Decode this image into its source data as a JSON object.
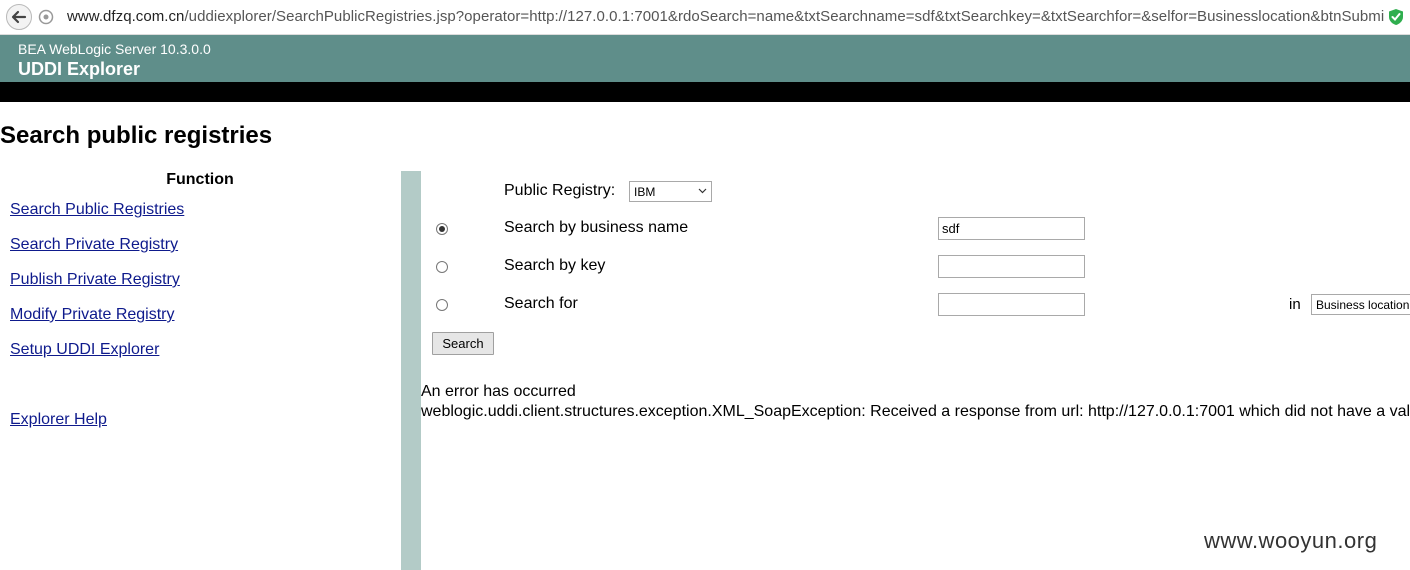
{
  "browser": {
    "url_host": "www.dfzq.com.cn",
    "url_rest": "/uddiexplorer/SearchPublicRegistries.jsp?operator=http://127.0.0.1:7001&rdoSearch=name&txtSearchname=sdf&txtSearchkey=&txtSearchfor=&selfor=Businesslocation&btnSubmi"
  },
  "header": {
    "product": "BEA WebLogic Server 10.3.0.0",
    "app_title": "UDDI Explorer"
  },
  "page_title": "Search public registries",
  "sidebar": {
    "heading": "Function",
    "items": [
      {
        "label": "Search Public Registries"
      },
      {
        "label": "Search Private Registry"
      },
      {
        "label": "Publish Private Registry"
      },
      {
        "label": "Modify Private Registry"
      },
      {
        "label": "Setup UDDI Explorer"
      }
    ],
    "help": "Explorer Help"
  },
  "form": {
    "registry_label": "Public Registry:",
    "registry_value": "IBM",
    "by_name_label": "Search by business name",
    "by_name_value": "sdf",
    "by_key_label": "Search by key",
    "by_key_value": "",
    "search_for_label": "Search for",
    "search_for_value": "",
    "in_label": "in",
    "in_value": "Business location",
    "selected_option": "name",
    "submit_label": "Search"
  },
  "error": {
    "title": "An error has occurred",
    "message": "weblogic.uddi.client.structures.exception.XML_SoapException: Received a response from url: http://127.0.0.1:7001 which did not have a val"
  },
  "watermark": "www.wooyun.org",
  "colors": {
    "header_bg": "#5f8e8a",
    "divider": "#b3cbc7",
    "link": "#0e1a8c"
  }
}
